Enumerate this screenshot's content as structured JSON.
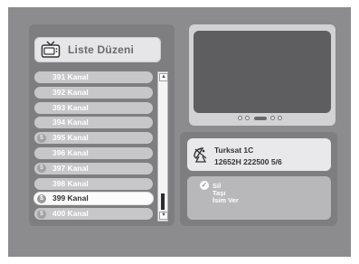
{
  "title": "Liste Düzeni",
  "channels": [
    {
      "label": "391 Kanal",
      "pay": false,
      "selected": false
    },
    {
      "label": "392 Kanal",
      "pay": false,
      "selected": false
    },
    {
      "label": "393 Kanal",
      "pay": false,
      "selected": false
    },
    {
      "label": "394 Kanal",
      "pay": false,
      "selected": false
    },
    {
      "label": "395 Kanal",
      "pay": true,
      "selected": false
    },
    {
      "label": "396 Kanal",
      "pay": false,
      "selected": false
    },
    {
      "label": "397 Kanal",
      "pay": true,
      "selected": false
    },
    {
      "label": "398 Kanal",
      "pay": false,
      "selected": false
    },
    {
      "label": "399 Kanal",
      "pay": true,
      "selected": true
    },
    {
      "label": "400 Kanal",
      "pay": true,
      "selected": false
    }
  ],
  "pay_symbol": "$",
  "scroll": {
    "up_icon": "▲",
    "down_icon": "▼",
    "position": 0.9
  },
  "satellite": {
    "name": "Turksat 1C",
    "transponder": "12652H 222500 5/6",
    "icon": "satellite-dish-icon"
  },
  "menu": {
    "check_icon": "✓",
    "items": [
      "Sil",
      "Taşı",
      "İsim Ver"
    ]
  },
  "icons": {
    "tv": "tv-icon",
    "check": "check-icon"
  },
  "colors": {
    "panel_bg": "#8c8c8e",
    "row_normal": "#c7c7c9",
    "row_selected": "#fbfbfb",
    "preview_screen": "#5e5e60"
  }
}
